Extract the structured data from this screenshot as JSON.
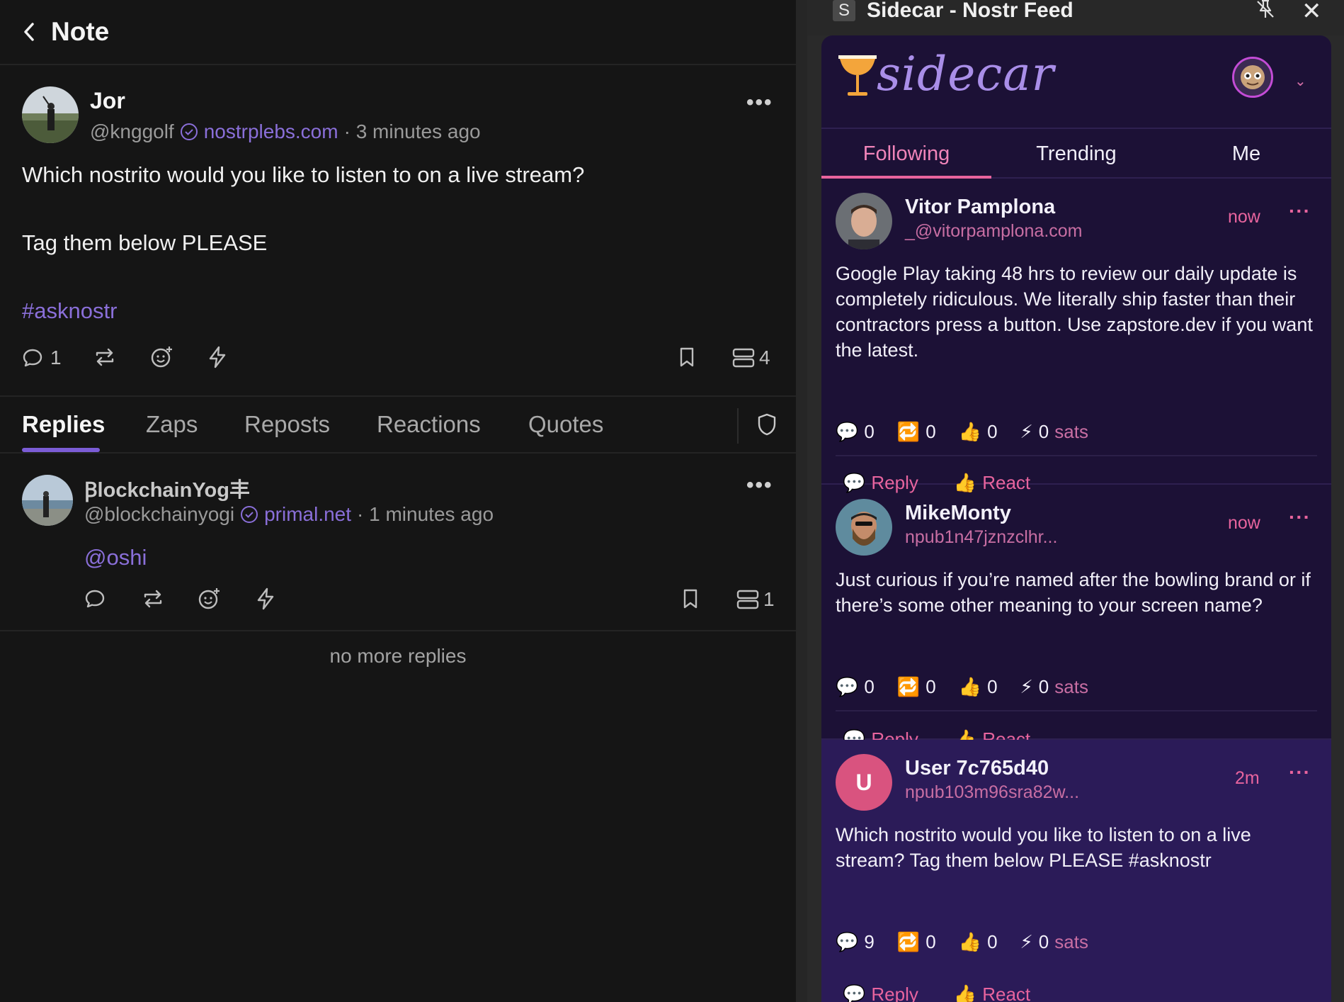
{
  "left": {
    "header": {
      "title": "Note"
    },
    "note": {
      "author": "Jor",
      "handle": "@knggolf",
      "nip05": "nostrplebs.com",
      "time": "· 3 minutes ago",
      "line1": "Which nostrito would you like to listen to on a live stream?",
      "line2": "Tag them below PLEASE",
      "hashtag": "#asknostr",
      "reply_count": "1",
      "relay_count": "4"
    },
    "tabs": [
      "Replies",
      "Zaps",
      "Reposts",
      "Reactions",
      "Quotes"
    ],
    "reply": {
      "author": "ꞴlockchainYog丰",
      "handle": "@blockchainyogi",
      "nip05": "primal.net",
      "time": "· 1 minutes ago",
      "mention": "@oshi",
      "relay_count": "1"
    },
    "no_more": "no more replies"
  },
  "window": {
    "title_badge": "S",
    "title": "Sidecar - Nostr Feed",
    "logo": "sidecar",
    "tabs": [
      "Following",
      "Trending",
      "Me"
    ],
    "active_tab": "Following",
    "posts": [
      {
        "name": "Vitor Pamplona",
        "handle": "_@vitorpamplona.com",
        "time": "now",
        "body": "Google Play taking 48 hrs to review our daily update is completely ridiculous. We literally ship faster than their contractors press a button. Use zapstore.dev if you want the latest.",
        "replies": "0",
        "reposts": "0",
        "likes": "0",
        "zaps": "0",
        "sats": "sats",
        "reply_btn": "Reply",
        "react_btn": "React"
      },
      {
        "name": "MikeMonty",
        "handle": "npub1n47jznzclhr...",
        "time": "now",
        "body": "Just curious if you’re named after the bowling brand or if there’s some other meaning to your screen name?",
        "replies": "0",
        "reposts": "0",
        "likes": "0",
        "zaps": "0",
        "sats": "sats",
        "reply_btn": "Reply",
        "react_btn": "React"
      },
      {
        "name": "User 7c765d40",
        "initial": "U",
        "handle": "npub103m96sra82w...",
        "time": "2m",
        "body": "Which nostrito would you like to listen to on a live stream? Tag them below PLEASE #asknostr",
        "replies": "9",
        "reposts": "0",
        "likes": "0",
        "zaps": "0",
        "sats": "sats",
        "reply_btn": "Reply",
        "react_btn": "React"
      }
    ]
  },
  "colors": {
    "accent_purple": "#8a6fd9",
    "accent_pink": "#e8649e",
    "panel_bg": "#1c1136"
  }
}
